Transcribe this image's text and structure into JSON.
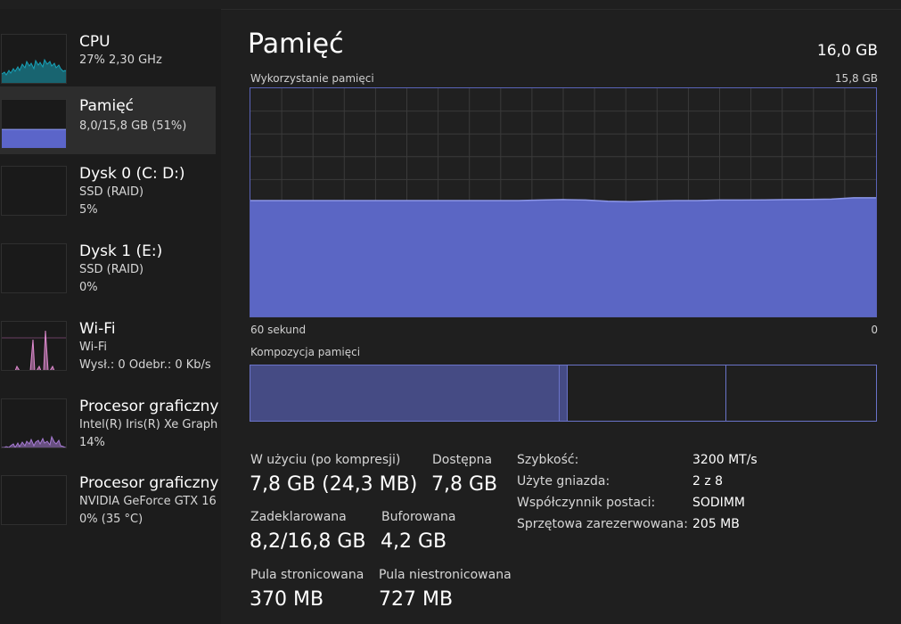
{
  "sidebar": {
    "items": [
      {
        "title": "CPU",
        "line1": "27%  2,30 GHz",
        "line2": "",
        "graph_color": "#17a2b8",
        "icon": "cpu-graph"
      },
      {
        "title": "Pamięć",
        "line1": "8,0/15,8 GB (51%)",
        "line2": "",
        "graph_color": "#5b65c9",
        "icon": "memory-graph",
        "usage_fraction": 0.51
      },
      {
        "title": "Dysk 0 (C: D:)",
        "line1": "SSD (RAID)",
        "line2": "5%",
        "graph_color": "#3b9a77",
        "icon": "disk-graph"
      },
      {
        "title": "Dysk 1 (E:)",
        "line1": "SSD (RAID)",
        "line2": "0%",
        "graph_color": "#3b9a77",
        "icon": "disk-graph"
      },
      {
        "title": "Wi-Fi",
        "line1": "Wi-Fi",
        "line2": "Wysł.: 0  Odebr.: 0 Kb/s",
        "graph_color": "#e08bd0",
        "icon": "wifi-graph"
      },
      {
        "title": "Procesor graficzny",
        "line1": "Intel(R) Iris(R) Xe Graph",
        "line2": "14%",
        "graph_color": "#a77bd4",
        "icon": "gpu-graph"
      },
      {
        "title": "Procesor graficzny",
        "line1": "NVIDIA GeForce GTX 16",
        "line2": "0%  (35 °C)",
        "graph_color": "#a77bd4",
        "icon": "gpu-graph"
      }
    ]
  },
  "main": {
    "title": "Pamięć",
    "total": "16,0 GB",
    "usage_graph": {
      "label": "Wykorzystanie pamięci",
      "max_label": "15,8 GB",
      "x_left_label": "60 sekund",
      "x_right_label": "0",
      "fill_color": "#5b66c4",
      "line_color": "#8c96e8",
      "grid_color": "#3a3a3a",
      "series_fraction": [
        0.508,
        0.508,
        0.508,
        0.508,
        0.508,
        0.508,
        0.508,
        0.508,
        0.508,
        0.508,
        0.508,
        0.508,
        0.508,
        0.51,
        0.512,
        0.51,
        0.505,
        0.503,
        0.506,
        0.508,
        0.508,
        0.51,
        0.51,
        0.511,
        0.512,
        0.513,
        0.514,
        0.52,
        0.52
      ]
    },
    "composition": {
      "label": "Kompozycja pamięci",
      "segments_fraction": [
        {
          "name": "in_use",
          "fraction": 0.494,
          "color": "#454b84"
        },
        {
          "name": "modified",
          "fraction": 0.013,
          "color": "#454b84"
        },
        {
          "name": "standby",
          "fraction": 0.253,
          "color": "#1f1f1f"
        },
        {
          "name": "free",
          "fraction": 0.24,
          "color": "#1f1f1f"
        }
      ]
    },
    "stats": {
      "in_use_label": "W użyciu (po kompresji)",
      "in_use_value": "7,8 GB (24,3 MB)",
      "available_label": "Dostępna",
      "available_value": "7,8 GB",
      "committed_label": "Zadeklarowana",
      "committed_value": "8,2/16,8 GB",
      "cached_label": "Buforowana",
      "cached_value": "4,2 GB",
      "paged_label": "Pula stronicowana",
      "paged_value": "370 MB",
      "nonpaged_label": "Pula niestronicowana",
      "nonpaged_value": "727 MB"
    },
    "details": [
      {
        "key": "Szybkość:",
        "value": "3200 MT/s"
      },
      {
        "key": "Użyte gniazda:",
        "value": "2 z 8"
      },
      {
        "key": "Współczynnik postaci:",
        "value": "SODIMM"
      },
      {
        "key": "Sprzętowa zarezerwowana:",
        "value": "205 MB"
      }
    ]
  }
}
